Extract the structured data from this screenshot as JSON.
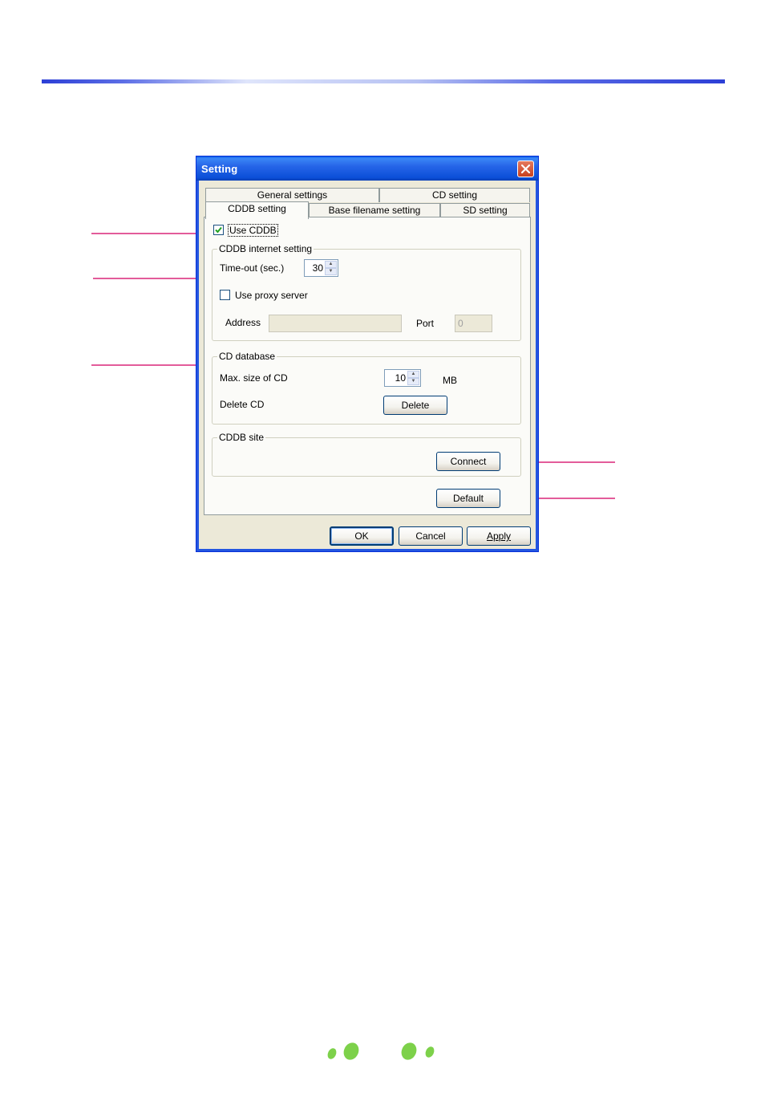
{
  "dialog": {
    "title": "Setting",
    "close_icon": "close-icon"
  },
  "tabs": {
    "row1": [
      "General settings",
      "CD setting"
    ],
    "row2": [
      "CDDB setting",
      "Base filename setting",
      "SD setting"
    ],
    "active": "CDDB setting"
  },
  "cddb": {
    "use_cddb_label": "Use CDDB",
    "use_cddb_checked": true,
    "internet_group_label": "CDDB internet setting",
    "timeout_label": "Time-out (sec.)",
    "timeout_value": "30",
    "use_proxy_label": "Use proxy server",
    "use_proxy_checked": false,
    "address_label": "Address",
    "address_value": "",
    "port_label": "Port",
    "port_value": "0",
    "database_group_label": "CD database",
    "max_size_label": "Max. size of CD",
    "max_size_value": "10",
    "max_size_unit": "MB",
    "delete_cd_label": "Delete CD",
    "delete_button": "Delete",
    "site_group_label": "CDDB site",
    "connect_button": "Connect",
    "default_button": "Default"
  },
  "footer": {
    "ok_button": "OK",
    "cancel_button": "Cancel",
    "apply_button": "Apply"
  },
  "colors": {
    "callout": "#e35c9a",
    "title_bar": "#0b4fd8",
    "decor_green": "#7dd14a"
  }
}
